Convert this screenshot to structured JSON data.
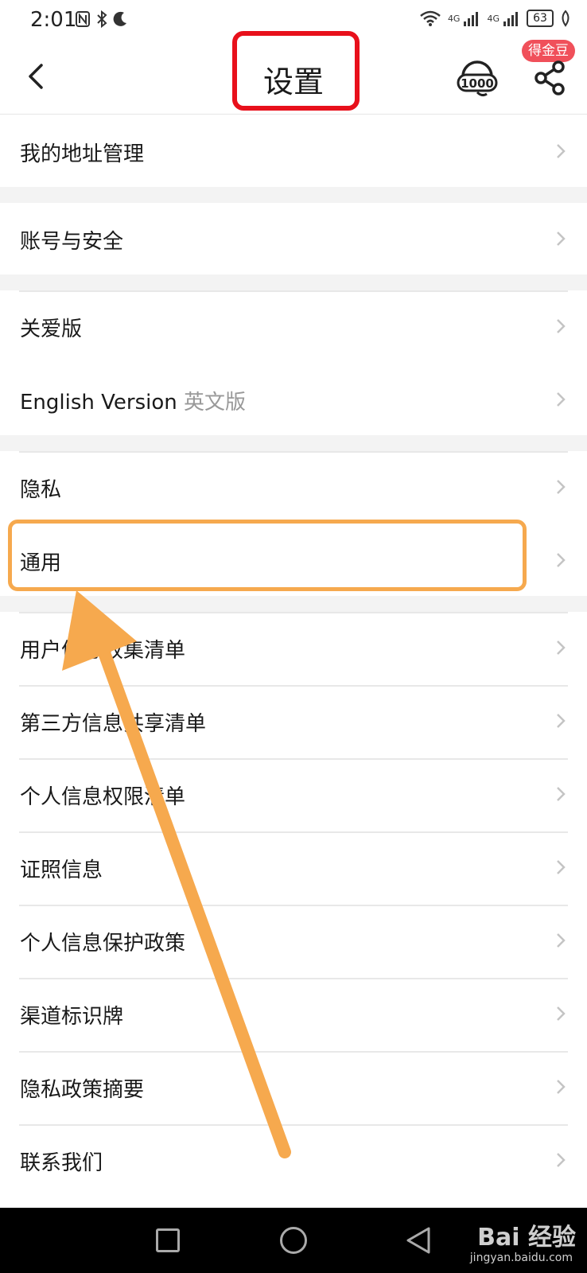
{
  "status_bar": {
    "time": "2:01",
    "network_1": "4G",
    "network_2": "4G",
    "battery": "63"
  },
  "nav": {
    "title": "设置",
    "coin_badge": "得金豆",
    "service_label": "1000"
  },
  "items": [
    {
      "label": "我的地址管理"
    },
    {
      "label": "账号与安全"
    },
    {
      "label": "关爱版"
    },
    {
      "label": "English Version",
      "sub": "英文版"
    },
    {
      "label": "隐私"
    },
    {
      "label": "通用"
    },
    {
      "label": "用户信息收集清单"
    },
    {
      "label": "第三方信息共享清单"
    },
    {
      "label": "个人信息权限清单"
    },
    {
      "label": "证照信息"
    },
    {
      "label": "个人信息保护政策"
    },
    {
      "label": "渠道标识牌"
    },
    {
      "label": "隐私政策摘要"
    },
    {
      "label": "联系我们"
    }
  ],
  "watermark": {
    "brand": "Bai 经验",
    "url": "jingyan.baidu.com"
  },
  "colors": {
    "title_highlight": "#e8101b",
    "annotation_orange": "#f6a94e",
    "badge": "#f0505a"
  }
}
